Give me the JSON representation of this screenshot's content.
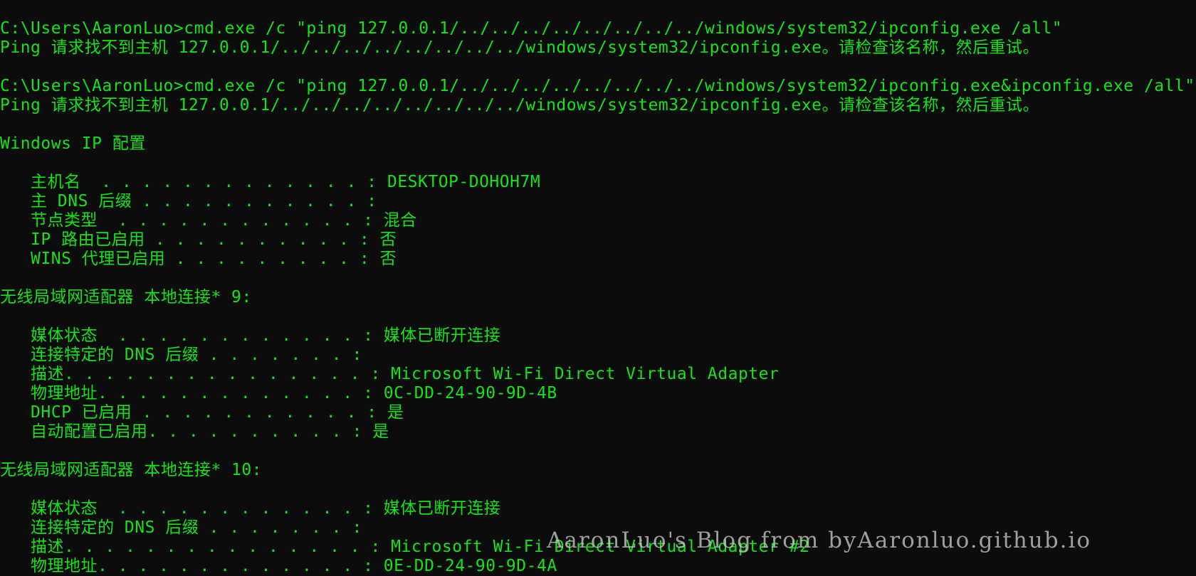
{
  "colors": {
    "background": "#0c0c0c",
    "console_text": "#13e317",
    "watermark_text": "#c8c8c8"
  },
  "console": {
    "lines": [
      "C:\\Users\\AaronLuo>cmd.exe /c \"ping 127.0.0.1/../../../../../../../../windows/system32/ipconfig.exe /all\"",
      "Ping 请求找不到主机 127.0.0.1/../../../../../../../../windows/system32/ipconfig.exe。请检查该名称，然后重试。",
      "",
      "C:\\Users\\AaronLuo>cmd.exe /c \"ping 127.0.0.1/../../../../../../../../windows/system32/ipconfig.exe&ipconfig.exe /all\"",
      "Ping 请求找不到主机 127.0.0.1/../../../../../../../../windows/system32/ipconfig.exe。请检查该名称，然后重试。",
      "",
      "Windows IP 配置",
      "",
      "   主机名  . . . . . . . . . . . . . : DESKTOP-DOHOH7M",
      "   主 DNS 后缀 . . . . . . . . . . . :",
      "   节点类型  . . . . . . . . . . . . : 混合",
      "   IP 路由已启用 . . . . . . . . . . : 否",
      "   WINS 代理已启用 . . . . . . . . . : 否",
      "",
      "无线局域网适配器 本地连接* 9:",
      "",
      "   媒体状态  . . . . . . . . . . . . : 媒体已断开连接",
      "   连接特定的 DNS 后缀 . . . . . . . :",
      "   描述. . . . . . . . . . . . . . . : Microsoft Wi-Fi Direct Virtual Adapter",
      "   物理地址. . . . . . . . . . . . . : 0C-DD-24-90-9D-4B",
      "   DHCP 已启用 . . . . . . . . . . . : 是",
      "   自动配置已启用. . . . . . . . . . : 是",
      "",
      "无线局域网适配器 本地连接* 10:",
      "",
      "   媒体状态  . . . . . . . . . . . . : 媒体已断开连接",
      "   连接特定的 DNS 后缀 . . . . . . . :",
      "   描述. . . . . . . . . . . . . . . : Microsoft Wi-Fi Direct Virtual Adapter #2",
      "   物理地址. . . . . . . . . . . . . : 0E-DD-24-90-9D-4A"
    ]
  },
  "watermark": "AaronLuo's Blog from byAaronluo.github.io"
}
